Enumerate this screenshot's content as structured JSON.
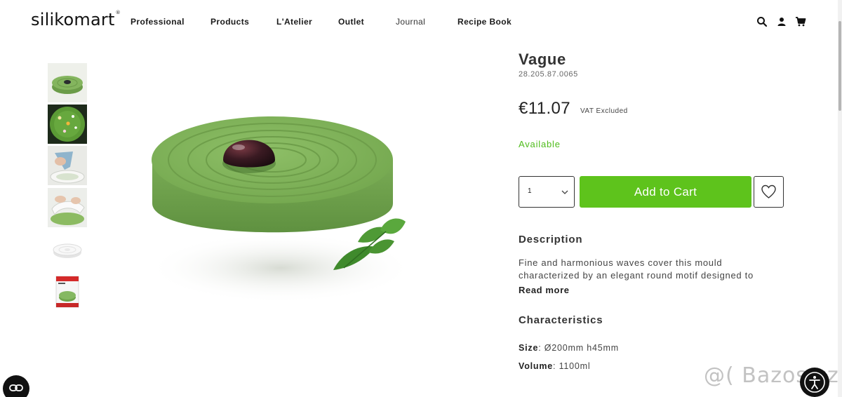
{
  "header": {
    "logo": "silikomart",
    "logo_mark": "®",
    "nav": [
      "Professional",
      "Products",
      "L'Atelier",
      "Outlet",
      "Journal",
      "Recipe Book"
    ],
    "icons": [
      "search-icon",
      "account-icon",
      "cart-icon"
    ]
  },
  "gallery": {
    "thumbnails": [
      "mould-green-top-view",
      "cake-decorated-flowers",
      "piping-into-mould",
      "unmolding-cake",
      "white-mould",
      "product-box"
    ],
    "main_image": "green-wave-cake"
  },
  "product": {
    "title": "Vague",
    "sku": "28.205.87.0065",
    "price": "€11.07",
    "vat_note": "VAT Excluded",
    "availability": "Available",
    "quantity": "1",
    "add_to_cart": "Add to Cart",
    "description_heading": "Description",
    "description": "Fine and harmonious waves cover this mould characterized by an elegant round motif designed to",
    "read_more": "Read more",
    "characteristics_heading": "Characteristics",
    "characteristics": [
      {
        "label": "Size",
        "value": ": Ø200mm h45mm"
      },
      {
        "label": "Volume",
        "value": ": 1100ml"
      }
    ]
  },
  "watermark": "@( Bazos.cz",
  "colors": {
    "accent_green": "#5ec31c",
    "available_green": "#4fbc1c",
    "cake_green": "#7fb35a"
  }
}
